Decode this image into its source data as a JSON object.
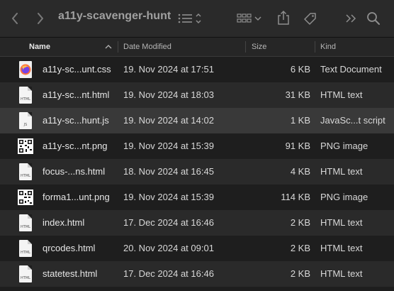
{
  "toolbar": {
    "title": "a11y-scavenger-hunt",
    "back_icon": "chevron-left",
    "forward_icon": "chevron-right",
    "list_view_icon": "list",
    "group_icon": "grid",
    "share_icon": "share",
    "tag_icon": "tag",
    "more_icon": "double-chevron-right",
    "search_icon": "magnifying-glass"
  },
  "columns": {
    "name": "Name",
    "date": "Date Modified",
    "size": "Size",
    "kind": "Kind"
  },
  "files": [
    {
      "name": "a11y-sc...unt.css",
      "date": "19. Nov 2024 at 17:51",
      "size": "6 KB",
      "kind": "Text Document",
      "icon": "firefox-icon"
    },
    {
      "name": "a11y-sc...nt.html",
      "date": "19. Nov 2024 at 18:03",
      "size": "31 KB",
      "kind": "HTML text",
      "icon": "html-file-icon",
      "label": "HTML"
    },
    {
      "name": "a11y-sc...hunt.js",
      "date": "19. Nov 2024 at 14:02",
      "size": "1 KB",
      "kind": "JavaSc...t script",
      "icon": "js-file-icon",
      "label": "JS"
    },
    {
      "name": "a11y-sc...nt.png",
      "date": "19. Nov 2024 at 15:39",
      "size": "91 KB",
      "kind": "PNG image",
      "icon": "qr-image-icon"
    },
    {
      "name": "focus-...ns.html",
      "date": "18. Nov 2024 at 16:45",
      "size": "4 KB",
      "kind": "HTML text",
      "icon": "html-file-icon",
      "label": "HTML"
    },
    {
      "name": "forma1...unt.png",
      "date": "19. Nov 2024 at 15:39",
      "size": "114 KB",
      "kind": "PNG image",
      "icon": "qr-image-icon"
    },
    {
      "name": "index.html",
      "date": "17. Dec 2024 at 16:46",
      "size": "2 KB",
      "kind": "HTML text",
      "icon": "html-file-icon",
      "label": "HTML"
    },
    {
      "name": "qrcodes.html",
      "date": "20. Nov 2024 at 09:01",
      "size": "2 KB",
      "kind": "HTML text",
      "icon": "html-file-icon",
      "label": "HTML"
    },
    {
      "name": "statetest.html",
      "date": "17. Dec 2024 at 16:46",
      "size": "2 KB",
      "kind": "HTML text",
      "icon": "html-file-icon",
      "label": "HTML"
    }
  ],
  "colors": {
    "background": "#1e1e1e",
    "toolbar": "#2a2a2a",
    "alt_row": "#2a2a2a",
    "selected_row": "#393939",
    "text": "#e6e6e6"
  }
}
